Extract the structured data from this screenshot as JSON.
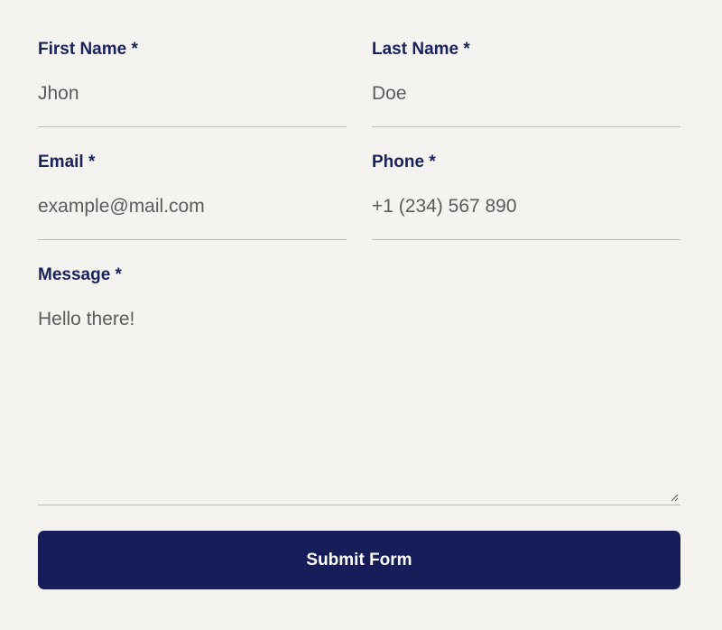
{
  "form": {
    "first_name": {
      "label": "First Name *",
      "value": "Jhon"
    },
    "last_name": {
      "label": "Last Name *",
      "value": "Doe"
    },
    "email": {
      "label": "Email *",
      "value": "example@mail.com"
    },
    "phone": {
      "label": "Phone *",
      "value": "+1 (234) 567 890"
    },
    "message": {
      "label": "Message *",
      "value": "Hello there!"
    },
    "submit_label": "Submit Form"
  },
  "colors": {
    "background": "#f5f3ef",
    "label": "#19225c",
    "value_text": "#5b5b5b",
    "underline": "#bdbab3",
    "button": "#161d58",
    "button_text": "#ffffff"
  },
  "icons": {
    "message_resize": "resize-grip-icon"
  }
}
